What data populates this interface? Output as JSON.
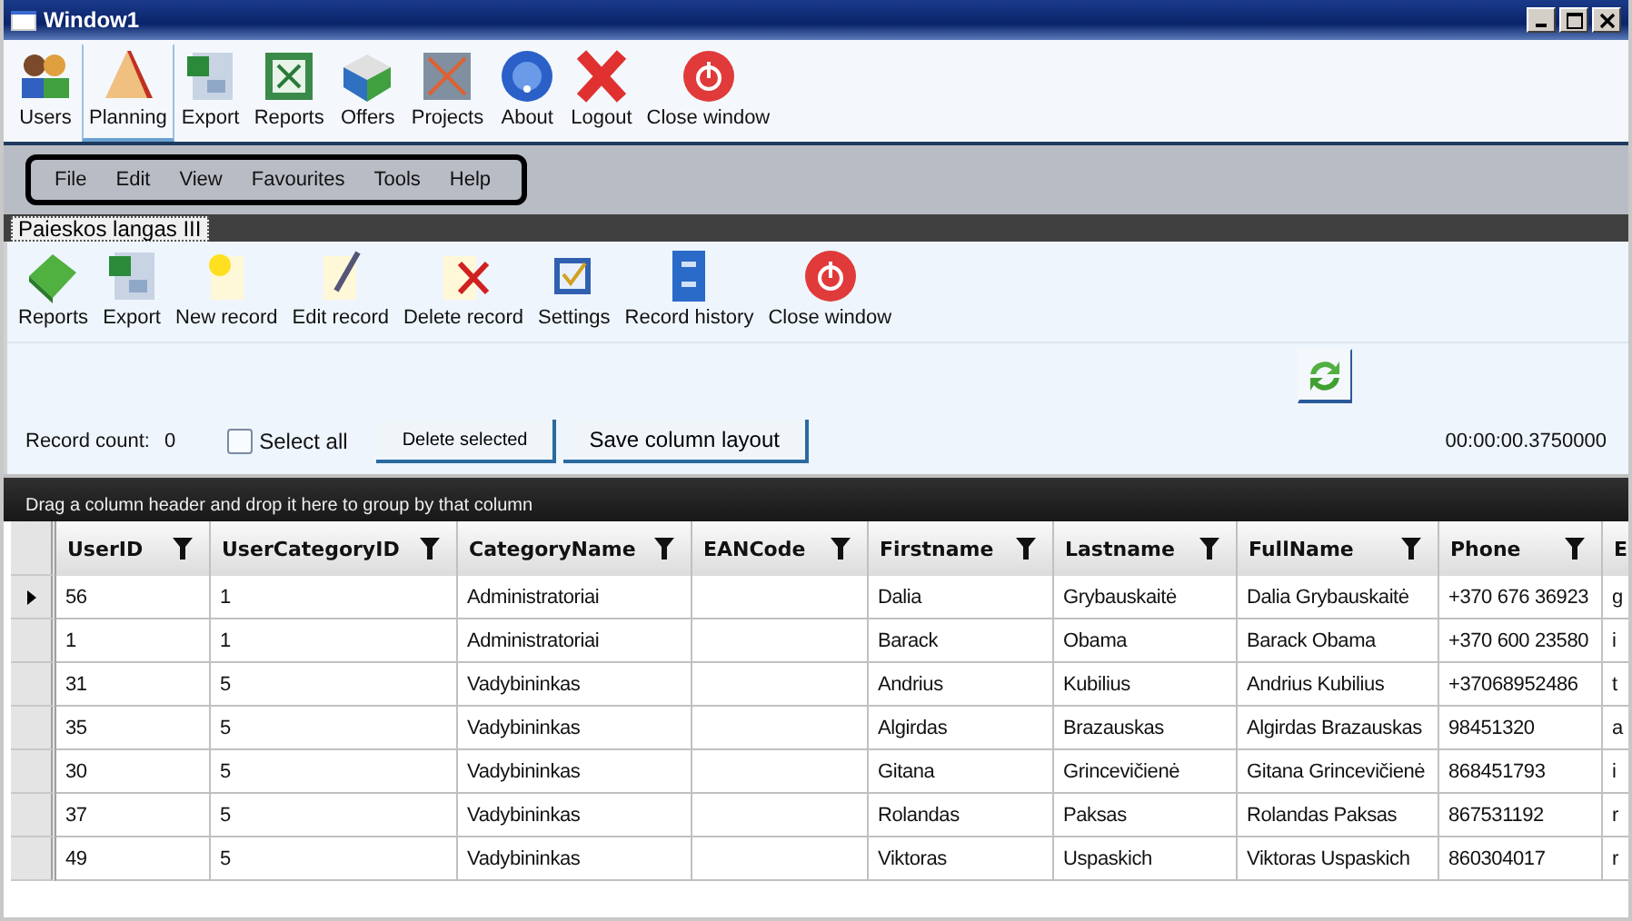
{
  "window": {
    "title": "Window1"
  },
  "main_toolbar": [
    {
      "label": "Users",
      "selected": false
    },
    {
      "label": "Planning",
      "selected": true
    },
    {
      "label": "Export",
      "selected": false
    },
    {
      "label": "Reports",
      "selected": false
    },
    {
      "label": "Offers",
      "selected": false
    },
    {
      "label": "Projects",
      "selected": false
    },
    {
      "label": "About",
      "selected": false
    },
    {
      "label": "Logout",
      "selected": false
    },
    {
      "label": "Close window",
      "selected": false
    }
  ],
  "menu": [
    "File",
    "Edit",
    "View",
    "Favourites",
    "Tools",
    "Help"
  ],
  "tab": {
    "label": "Paieskos langas III"
  },
  "record_toolbar": [
    "Reports",
    "Export",
    "New record",
    "Edit record",
    "Delete record",
    "Settings",
    "Record history",
    "Close window"
  ],
  "record_count": {
    "label": "Record count:",
    "value": "0"
  },
  "select_all": {
    "label": "Select all",
    "checked": false
  },
  "buttons": [
    "Delete selected",
    "Save column layout"
  ],
  "elapsed": "00:00:00.3750000",
  "group_panel": "Drag a column header and drop it here to group by that column",
  "table": {
    "columns": [
      {
        "label": "UserID",
        "filter": true
      },
      {
        "label": "UserCategoryID",
        "filter": true
      },
      {
        "label": "CategoryName",
        "filter": true
      },
      {
        "label": "EANCode",
        "filter": true
      },
      {
        "label": "Firstname",
        "filter": true
      },
      {
        "label": "Lastname",
        "filter": true
      },
      {
        "label": "FullName",
        "filter": true
      },
      {
        "label": "Phone",
        "filter": true
      },
      {
        "label": "E"
      }
    ],
    "rows": [
      {
        "current": true,
        "cells": [
          "56",
          "1",
          "Administratoriai",
          "",
          "Dalia",
          "Grybauskaitė",
          "Dalia Grybauskaitė",
          "+370 676 36923",
          "g"
        ]
      },
      {
        "current": false,
        "cells": [
          "1",
          "1",
          "Administratoriai",
          "",
          "Barack",
          "Obama",
          "Barack Obama",
          "+370 600 23580",
          "i"
        ]
      },
      {
        "current": false,
        "cells": [
          "31",
          "5",
          "Vadybininkas",
          "",
          "Andrius",
          "Kubilius",
          "Andrius Kubilius",
          "+37068952486",
          "t"
        ]
      },
      {
        "current": false,
        "cells": [
          "35",
          "5",
          "Vadybininkas",
          "",
          "Algirdas",
          "Brazauskas",
          "Algirdas Brazauskas",
          "98451320",
          "a"
        ]
      },
      {
        "current": false,
        "cells": [
          "30",
          "5",
          "Vadybininkas",
          "",
          "Gitana",
          "Grincevičienė",
          "Gitana  Grincevičienė",
          "868451793",
          "i"
        ]
      },
      {
        "current": false,
        "cells": [
          "37",
          "5",
          "Vadybininkas",
          "",
          "Rolandas",
          "Paksas",
          "Rolandas Paksas",
          "867531192",
          "r"
        ]
      },
      {
        "current": false,
        "cells": [
          "49",
          "5",
          "Vadybininkas",
          "",
          "Viktoras",
          "Uspaskich",
          "Viktoras Uspaskich",
          "860304017",
          "r"
        ]
      }
    ]
  }
}
